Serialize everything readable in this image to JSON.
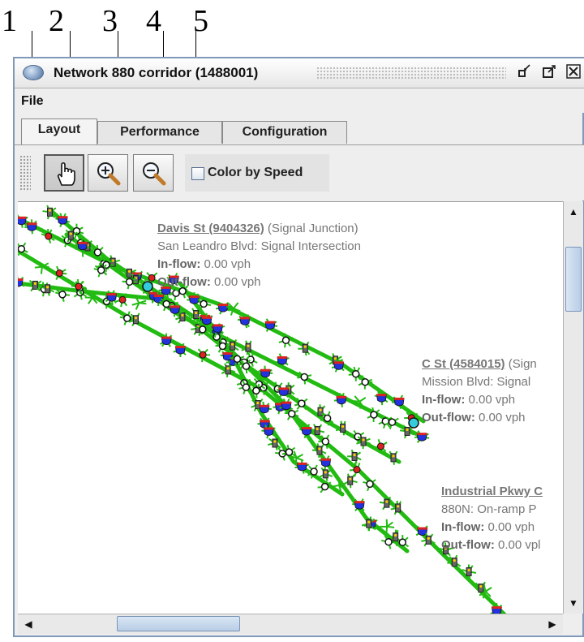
{
  "callouts": [
    "1",
    "2",
    "3",
    "4",
    "5"
  ],
  "window": {
    "title": "Network 880 corridor (1488001)",
    "controls": [
      "minimize-icon",
      "maximize-icon",
      "close-icon"
    ]
  },
  "menu": {
    "file": "File"
  },
  "tabs": [
    {
      "label": "Layout",
      "active": true
    },
    {
      "label": "Performance",
      "active": false
    },
    {
      "label": "Configuration",
      "active": false
    }
  ],
  "toolbar": {
    "pan_icon": "hand-pointer-icon",
    "zoom_in_icon": "zoom-in-icon",
    "zoom_out_icon": "zoom-out-icon",
    "color_by_speed_label": "Color by Speed",
    "color_by_speed_checked": false
  },
  "nodes": [
    {
      "link": "Davis St (9404326)",
      "type": " (Signal Junction)",
      "desc": "San Leandro Blvd: Signal Intersection",
      "inflow_label": "In-flow:",
      "inflow_value": " 0.00 vph",
      "outflow_label": "Out-flow:",
      "outflow_value": " 0.00 vph"
    },
    {
      "link": "C St (4584015)",
      "type": " (Sign",
      "desc": "Mission Blvd: Signal",
      "inflow_label": "In-flow:",
      "inflow_value": " 0.00 vph",
      "outflow_label": "Out-flow:",
      "outflow_value": " 0.00 vph"
    },
    {
      "link": "Industrial Pkwy C",
      "type": "",
      "desc": "880N: On-ramp P",
      "inflow_label": "In-flow:",
      "inflow_value": " 0.00 vph",
      "outflow_label": "Out-flow:",
      "outflow_value": " 0.00 vpl"
    }
  ],
  "colors": {
    "road": "#22bb11",
    "freeway_shield_blue": "#2233dd",
    "freeway_shield_red": "#dd2222",
    "junction_white": "#ffffff",
    "selected_node": "#33ccdd",
    "window_border": "#8099b8"
  }
}
